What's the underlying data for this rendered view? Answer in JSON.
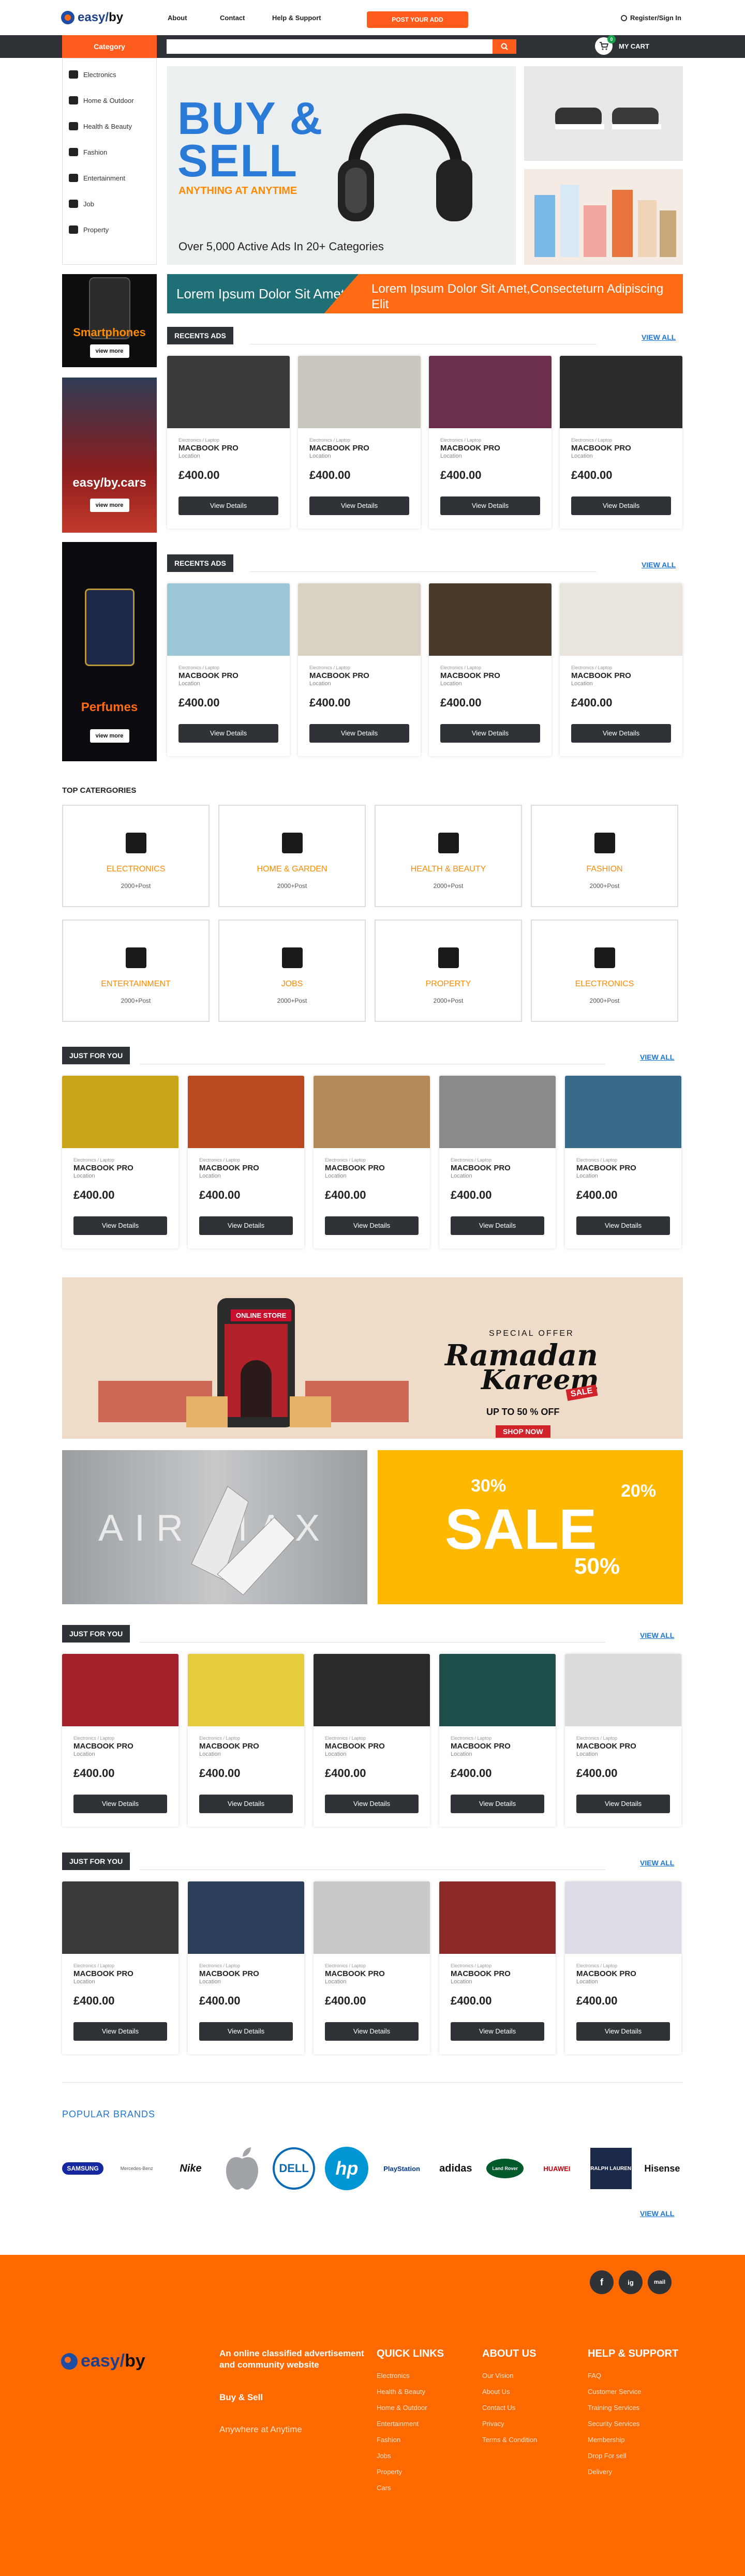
{
  "header": {
    "logo": {
      "main": "easy",
      "accent": "by"
    },
    "nav": [
      "About",
      "Contact",
      "Help & Support"
    ],
    "post_button": "POST YOUR ADD",
    "signin": "Register/Sign In"
  },
  "searchbar": {
    "category_label": "Category",
    "placeholder": "",
    "cart_label": "MY CART",
    "cart_count": "0"
  },
  "sidebar": {
    "items": [
      {
        "label": "Electronics",
        "icon": "tv-icon"
      },
      {
        "label": "Home & Outdoor",
        "icon": "home-icon"
      },
      {
        "label": "Health & Beauty",
        "icon": "health-icon"
      },
      {
        "label": "Fashion",
        "icon": "shirt-icon"
      },
      {
        "label": "Entertainment",
        "icon": "dice-icon"
      },
      {
        "label": "Job",
        "icon": "briefcase-icon"
      },
      {
        "label": "Property",
        "icon": "building-icon"
      }
    ]
  },
  "hero": {
    "line1": "BUY &",
    "line2": "SELL",
    "tagline": "ANYTHING AT ANYTIME",
    "count_text": "Over 5,000  Active Ads In 20+ Categories"
  },
  "ticker": {
    "left": "Lorem Ipsum Dolor Sit Amet,",
    "right": "Lorem Ipsum Dolor Sit Amet,Consecteturn Adipiscing Elit"
  },
  "promos": [
    {
      "title": "Smartphones",
      "button": "view more",
      "color": "#ff8a00"
    },
    {
      "title": "easy/by.cars",
      "button": "view more",
      "color": "#2a7ad8"
    },
    {
      "title": "Perfumes",
      "button": "view more",
      "color": "#ff6a14"
    }
  ],
  "sections": {
    "recent_ads": "RECENTS ADS",
    "view_all": "VIEW ALL",
    "top_categories": "TOP CATERGORIES",
    "just_for_you": "JUST FOR YOU",
    "popular_brands": "POPULAR BRANDS"
  },
  "product": {
    "tiny": "Electronics / Laptop",
    "name": "MACBOOK PRO",
    "location": "Location",
    "price": "£400.00",
    "button": "View Details"
  },
  "categories": [
    {
      "name": "ELECTRONICS",
      "posts": "2000+Post",
      "icon": "tv-icon"
    },
    {
      "name": "HOME & GARDEN",
      "posts": "2000+Post",
      "icon": "home-icon"
    },
    {
      "name": "HEALTH & BEAUTY",
      "posts": "2000+Post",
      "icon": "health-icon"
    },
    {
      "name": "FASHION",
      "posts": "2000+Post",
      "icon": "shirt-icon"
    },
    {
      "name": "ENTERTAINMENT",
      "posts": "2000+Post",
      "icon": "dice-icon"
    },
    {
      "name": "JOBS",
      "posts": "2000+Post",
      "icon": "briefcase-icon"
    },
    {
      "name": "PROPERTY",
      "posts": "2000+Post",
      "icon": "building-icon"
    },
    {
      "name": "ELECTRONICS",
      "posts": "2000+Post",
      "icon": "tv-icon"
    }
  ],
  "banners": {
    "online_store": "ONLINE STORE",
    "special_offer": "SPECIAL OFFER",
    "ramadan1": "Ramadan",
    "ramadan2": "Kareem",
    "sale_tag": "SALE",
    "upto": "UP TO 50 % OFF",
    "shop_now": "SHOP NOW",
    "air": "AIR MAX",
    "sale": "SALE",
    "pct1": "30%",
    "pct2": "20%",
    "pct3": "50%"
  },
  "brands": [
    "SAMSUNG",
    "Mercedes-Benz",
    "Nike",
    "Apple",
    "DELL",
    "hp",
    "PlayStation",
    "adidas",
    "Land Rover",
    "HUAWEI",
    "RALPH LAUREN",
    "Hisense"
  ],
  "footer": {
    "about_text": "An online classified advertisement and community website",
    "buy_sell": "Buy & Sell",
    "anywhere": "Anywhere at Anytime",
    "quick_links_title": "QUICK LINKS",
    "quick_links": [
      "Electronics",
      "Health & Beauty",
      "Home & Outdoor",
      "Entertainment",
      "Fashion",
      "Jobs",
      "Property",
      "Cars"
    ],
    "about_title": "ABOUT US",
    "about_links": [
      "Our Vision",
      "About Us",
      "Contact Us",
      "Privacy",
      "Terms & Condition"
    ],
    "help_title": "HELP & SUPPORT",
    "help_links": [
      "FAQ",
      "Customer Service",
      "Training Services",
      "Security Services",
      "Membership",
      "Drop For sell",
      "Delivery"
    ],
    "social": [
      "f",
      "ig",
      "mail"
    ]
  },
  "colors": {
    "accent": "#ff6a00",
    "dark": "#2f3337",
    "link": "#1d75d8"
  }
}
